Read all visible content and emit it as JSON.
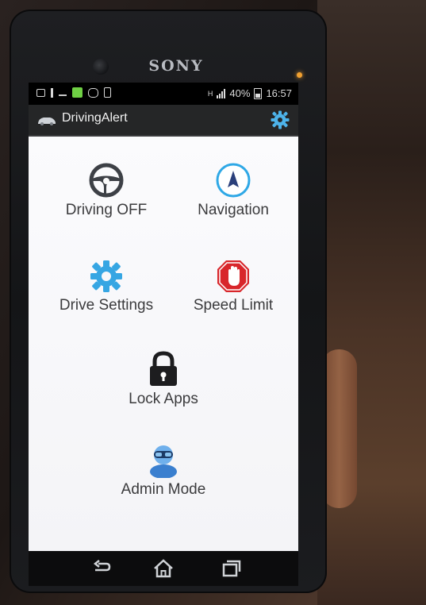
{
  "device": {
    "brand": "SONY"
  },
  "statusbar": {
    "battery_percent": "40%",
    "time": "16:57",
    "network": "H"
  },
  "app": {
    "title": "DrivingAlert",
    "accent": "#2fa8e6"
  },
  "menu": {
    "driving": {
      "label": "Driving OFF",
      "icon": "steering-wheel-icon"
    },
    "navigation": {
      "label": "Navigation",
      "icon": "navigation-arrow-icon"
    },
    "drive_settings": {
      "label": "Drive Settings",
      "icon": "gear-icon"
    },
    "speed_limit": {
      "label": "Speed Limit",
      "icon": "stop-hand-icon"
    },
    "lock_apps": {
      "label": "Lock Apps",
      "icon": "padlock-icon"
    },
    "admin_mode": {
      "label": "Admin Mode",
      "icon": "admin-user-icon"
    }
  },
  "navbar": {
    "back": "back-icon",
    "home": "home-icon",
    "recents": "recents-icon"
  }
}
